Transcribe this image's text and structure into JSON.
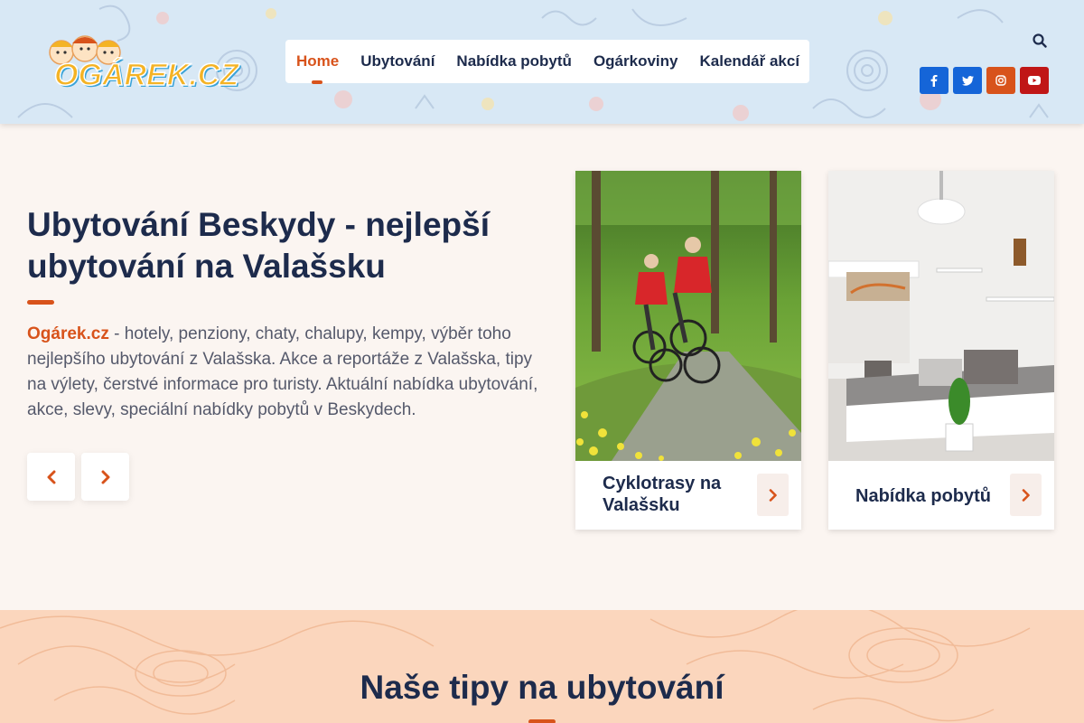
{
  "logo": {
    "text": "OGÁREK.CZ"
  },
  "nav": {
    "items": [
      {
        "label": "Home",
        "active": true
      },
      {
        "label": "Ubytování"
      },
      {
        "label": "Nabídka pobytů"
      },
      {
        "label": "Ogárkoviny"
      },
      {
        "label": "Kalendář akcí"
      }
    ]
  },
  "header": {
    "search_icon": "search-icon",
    "social": [
      {
        "name": "facebook-icon",
        "glyph": "f",
        "color": "#1565d8"
      },
      {
        "name": "twitter-icon",
        "glyph": "t",
        "color": "#1565d8"
      },
      {
        "name": "instagram-icon",
        "glyph": "ig",
        "color": "#d8531b"
      },
      {
        "name": "youtube-icon",
        "glyph": "▶",
        "color": "#c01616"
      }
    ]
  },
  "hero": {
    "title": "Ubytování Beskydy - nejlepší ubytování na Valašsku",
    "brand": "Ogárek.cz",
    "text": " - hotely, penziony, chaty, chalupy, kempy, výběr toho nejlepšího ubytování z Valašska. Akce a reportáže z Valašska, tipy na výlety, čerstvé informace pro turisty. Aktuální nabídka ubytování, akce, slevy, speciální nabídky pobytů v Beskydech."
  },
  "cards": [
    {
      "title": "Cyklotrasy na Valašsku"
    },
    {
      "title": "Nabídka pobytů"
    }
  ],
  "tips": {
    "title": "Naše tipy na ubytování"
  },
  "colors": {
    "accent": "#d8531b",
    "navy": "#1d2b4c",
    "peach": "#fbd6bd"
  }
}
